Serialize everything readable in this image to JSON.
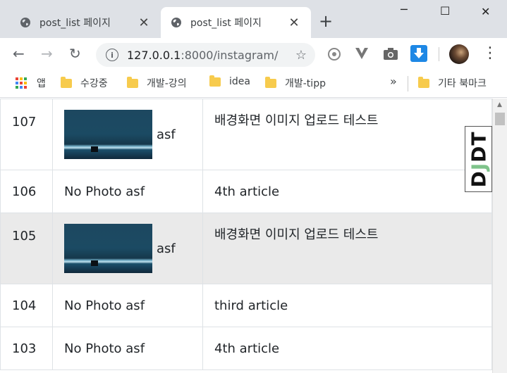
{
  "tabs": [
    {
      "title": "post_list 페이지",
      "active": false
    },
    {
      "title": "post_list 페이지",
      "active": true
    }
  ],
  "new_tab": "+",
  "window_controls": {
    "minimize": "─",
    "maximize": "☐",
    "close": "✕"
  },
  "toolbar": {
    "back": "←",
    "forward": "→",
    "reload": "↻",
    "url_host": "127.0.0.1",
    "url_path": ":8000/instagram/",
    "star": "☆",
    "menu": "⋮"
  },
  "bookmarks": {
    "apps_label": "앱",
    "items": [
      "수강중",
      "개발-강의",
      "idea",
      "개발-tipp"
    ],
    "overflow": "»",
    "other_label": "기타 북마크"
  },
  "posts": [
    {
      "id": "107",
      "has_photo": true,
      "no_photo_text": "",
      "author": "asf",
      "message": "배경화면 이미지 업로드 테스트"
    },
    {
      "id": "106",
      "has_photo": false,
      "no_photo_text": "No Photo",
      "author": "asf",
      "message": "4th article"
    },
    {
      "id": "105",
      "has_photo": true,
      "no_photo_text": "",
      "author": "asf",
      "message": "배경화면 이미지 업로드 테스트"
    },
    {
      "id": "104",
      "has_photo": false,
      "no_photo_text": "No Photo",
      "author": "asf",
      "message": "third article"
    },
    {
      "id": "103",
      "has_photo": false,
      "no_photo_text": "No Photo",
      "author": "asf",
      "message": "4th article"
    }
  ],
  "djdt": {
    "label_prefix": "D",
    "label_j": "J",
    "label_suffix": "DT"
  },
  "colors": {
    "tabstrip": "#dee1e6",
    "folder": "#f7cb4d",
    "striped_row": "#eaeaea",
    "djdt_accent": "#7ec38a"
  }
}
